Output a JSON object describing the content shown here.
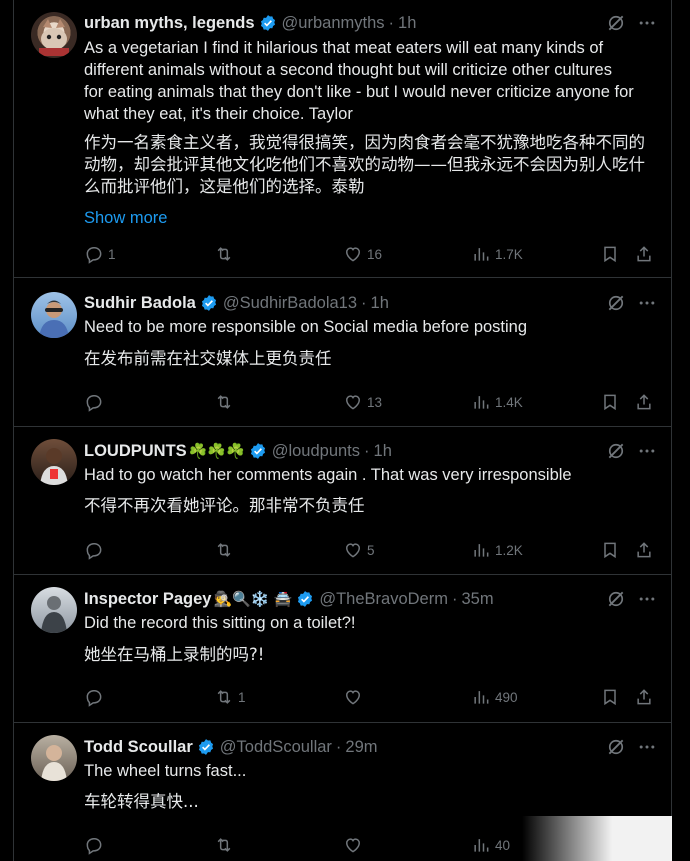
{
  "colors": {
    "bg": "#000000",
    "text": "#e7e9ea",
    "muted": "#71767b",
    "link": "#1d9bf0",
    "verified": "#1d9bf0",
    "border": "#2f3336"
  },
  "tweets": [
    {
      "name": "urban myths, legends",
      "handle": "@urbanmyths",
      "time": "1h",
      "emojis": "",
      "lines": [
        "As a vegetarian I find it hilarious that meat eaters will eat many kinds of",
        "different animals without a second thought but will criticize other cultures",
        "for eating animals that they don't like - but I would never criticize anyone for",
        "what they eat, it's their choice. Taylor"
      ],
      "translation_lines": [
        "作为一名素食主义者，我觉得很搞笑，因为肉食者会毫不犹豫地吃各种不同的",
        "动物，却会批评其他文化吃他们不喜欢的动物——但我永远不会因为别人吃什",
        "么而批评他们，这是他们的选择。泰勒"
      ],
      "show_more": "Show more",
      "replies": "1",
      "reposts": "",
      "likes": "16",
      "views": "1.7K"
    },
    {
      "name": "Sudhir Badola",
      "handle": "@SudhirBadola13",
      "time": "1h",
      "emojis": "",
      "lines": [
        "Need to be more responsible on Social media before posting"
      ],
      "translation_lines": [
        "在发布前需在社交媒体上更负责任"
      ],
      "replies": "",
      "reposts": "",
      "likes": "13",
      "views": "1.4K"
    },
    {
      "name": "LOUDPUNTS",
      "handle": "@loudpunts",
      "time": "1h",
      "emojis": "☘️☘️☘️",
      "lines": [
        "Had to go watch her comments again . That was very irresponsible"
      ],
      "translation_lines": [
        "不得不再次看她评论。那非常不负责任"
      ],
      "replies": "",
      "reposts": "",
      "likes": "5",
      "views": "1.2K"
    },
    {
      "name": "Inspector Pagey",
      "handle": "@TheBravoDerm",
      "time": "35m",
      "emojis": "🕵🔍❄️ 🚔",
      "lines": [
        "Did the record this sitting on a toilet?!"
      ],
      "translation_lines": [
        "她坐在马桶上录制的吗?!"
      ],
      "replies": "",
      "reposts": "1",
      "likes": "",
      "views": "490"
    },
    {
      "name": "Todd Scoullar",
      "handle": "@ToddScoullar",
      "time": "29m",
      "emojis": "",
      "lines": [
        "The wheel turns fast..."
      ],
      "translation_lines": [
        "车轮转得真快..."
      ],
      "replies": "",
      "reposts": "",
      "likes": "",
      "views": "40"
    }
  ],
  "icons": [
    "reply-icon",
    "repost-icon",
    "like-icon",
    "views-icon",
    "bookmark-icon",
    "share-icon",
    "grok-icon",
    "more-icon",
    "verified-badge-icon"
  ]
}
